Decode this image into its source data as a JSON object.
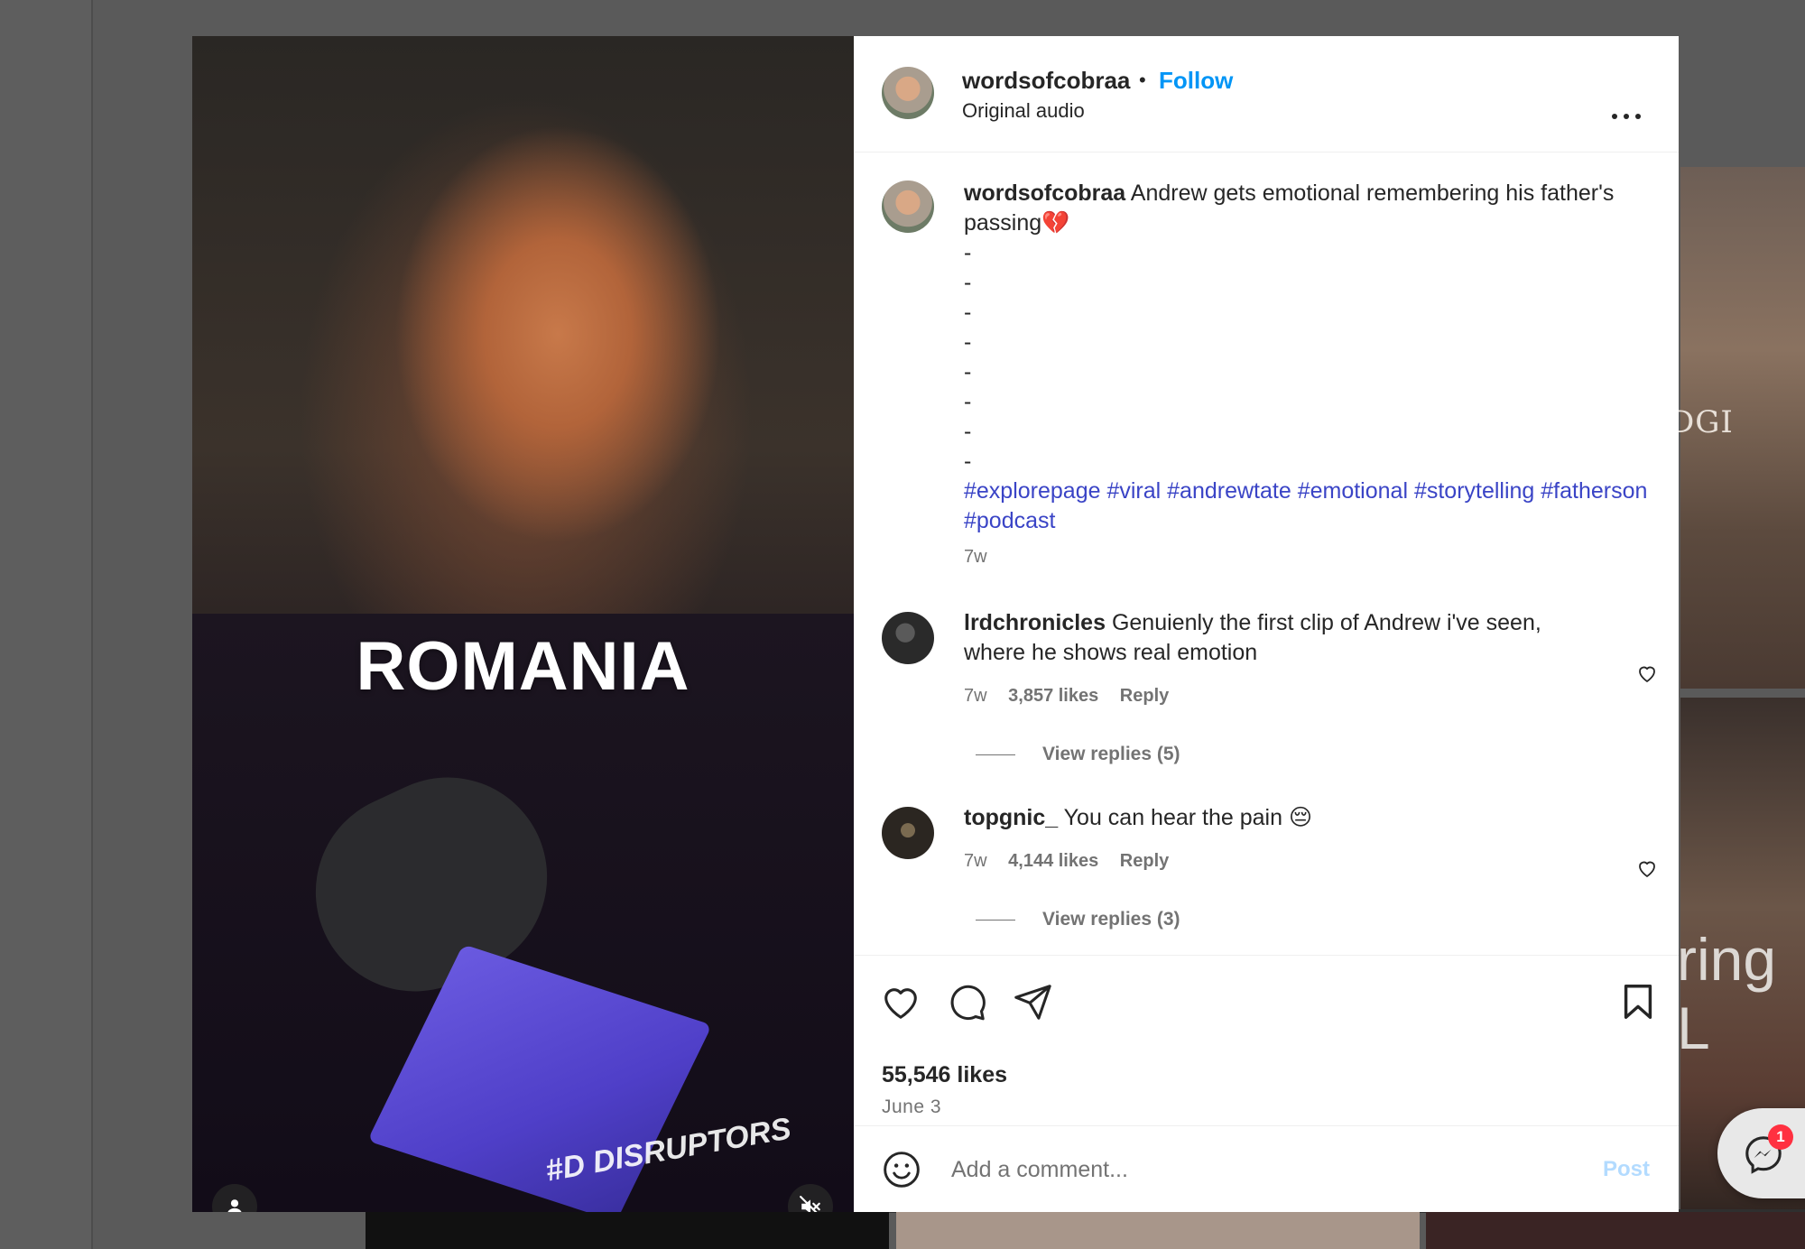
{
  "background": {
    "tile_text_1": "DGI",
    "tile_text_2": "ring L"
  },
  "media": {
    "overlay_text": "ROMANIA",
    "mic_cube_text": "#D DISRUPTORS",
    "user_icon": "user-icon",
    "mute_icon": "speaker-muted-icon"
  },
  "header": {
    "username": "wordsofcobraa",
    "separator": "•",
    "follow_label": "Follow",
    "audio_label": "Original audio",
    "more_icon": "more-horizontal-icon"
  },
  "caption": {
    "username": "wordsofcobraa",
    "text": "Andrew gets emotional remembering his father's passing💔",
    "dashes": [
      "-",
      "-",
      "-",
      "-",
      "-",
      "-",
      "-",
      "-"
    ],
    "hashtags": "#explorepage #viral #andrewtate #emotional #storytelling #fatherson #podcast",
    "time": "7w"
  },
  "comments": [
    {
      "username": "lrdchronicles",
      "text": "Genuienly the first clip of Andrew i've seen, where he shows real emotion",
      "time": "7w",
      "likes": "3,857 likes",
      "reply_label": "Reply",
      "view_replies": "View replies (5)"
    },
    {
      "username": "topgnic_",
      "text": "You can hear the pain 😔",
      "time": "7w",
      "likes": "4,144 likes",
      "reply_label": "Reply",
      "view_replies": "View replies (3)"
    }
  ],
  "actions": {
    "like_icon": "heart-icon",
    "comment_icon": "comment-icon",
    "share_icon": "send-icon",
    "save_icon": "bookmark-icon"
  },
  "likes_count": "55,546 likes",
  "date": "June 3",
  "comment_box": {
    "placeholder": "Add a comment...",
    "post_label": "Post"
  },
  "chat": {
    "badge_count": "1"
  },
  "colors": {
    "follow": "#0095f6",
    "hashtag": "#3a44c6",
    "badge": "#ff3040",
    "post_disabled": "#b3dbff"
  }
}
